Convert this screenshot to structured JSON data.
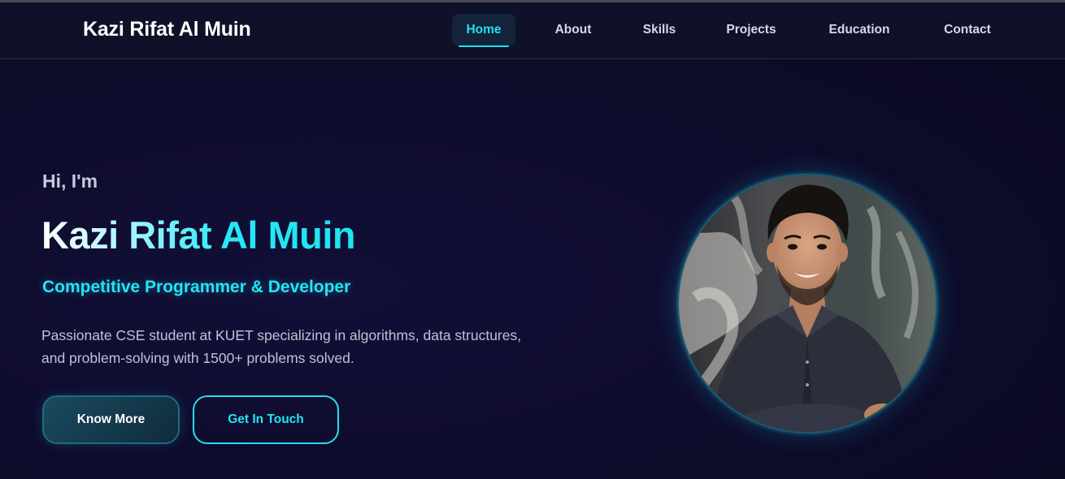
{
  "navbar": {
    "brand": "Kazi Rifat Al Muin",
    "links": [
      {
        "label": "Home",
        "active": true
      },
      {
        "label": "About",
        "active": false
      },
      {
        "label": "Skills",
        "active": false
      },
      {
        "label": "Projects",
        "active": false
      },
      {
        "label": "Education",
        "active": false
      },
      {
        "label": "Contact",
        "active": false
      }
    ]
  },
  "hero": {
    "greeting": "Hi, I'm",
    "name": "Kazi Rifat Al Muin",
    "role": "Competitive Programmer & Developer",
    "description": "Passionate CSE student at KUET specializing in algorithms, data structures, and problem-solving with 1500+ problems solved.",
    "primary_button": "Know More",
    "secondary_button": "Get In Touch"
  },
  "colors": {
    "accent": "#22e0f2",
    "background": "#0d0b2a",
    "navbar_bg": "#0e1128"
  },
  "icons": {
    "profile_photo": "profile-photo"
  }
}
